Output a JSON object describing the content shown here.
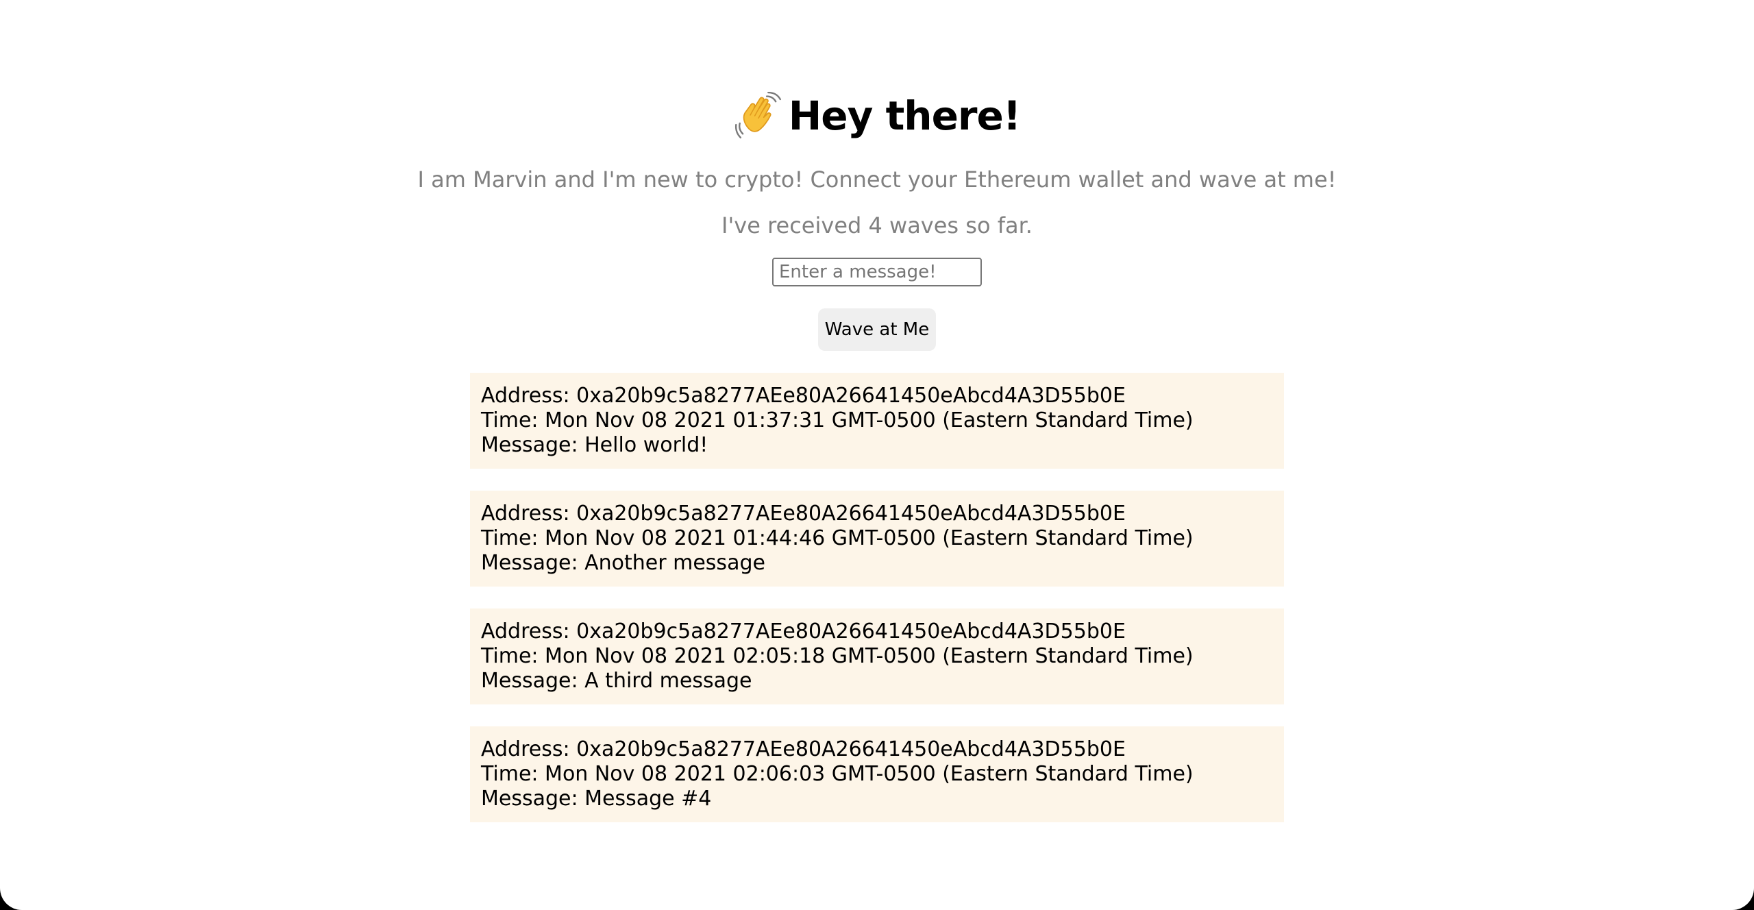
{
  "header": {
    "emoji": "👋",
    "title": "Hey there!"
  },
  "bio": "I am Marvin and I'm new to crypto! Connect your Ethereum wallet and wave at me!",
  "wave_count_text": "I've received 4 waves so far.",
  "message_input": {
    "placeholder": "Enter a message!",
    "value": ""
  },
  "wave_button": {
    "label": "Wave at Me"
  },
  "waves": [
    {
      "address": "Address: 0xa20b9c5a8277AEe80A26641450eAbcd4A3D55b0E",
      "time": "Time: Mon Nov 08 2021 01:37:31 GMT-0500 (Eastern Standard Time)",
      "message": "Message: Hello world!"
    },
    {
      "address": "Address: 0xa20b9c5a8277AEe80A26641450eAbcd4A3D55b0E",
      "time": "Time: Mon Nov 08 2021 01:44:46 GMT-0500 (Eastern Standard Time)",
      "message": "Message: Another message"
    },
    {
      "address": "Address: 0xa20b9c5a8277AEe80A26641450eAbcd4A3D55b0E",
      "time": "Time: Mon Nov 08 2021 02:05:18 GMT-0500 (Eastern Standard Time)",
      "message": "Message: A third message"
    },
    {
      "address": "Address: 0xa20b9c5a8277AEe80A26641450eAbcd4A3D55b0E",
      "time": "Time: Mon Nov 08 2021 02:06:03 GMT-0500 (Eastern Standard Time)",
      "message": "Message: Message #4"
    }
  ],
  "colors": {
    "card_background": "#fdf5e8",
    "muted_text": "#808080",
    "button_background": "#efefef"
  },
  "icons": {
    "wave": "waving-hand-icon"
  }
}
